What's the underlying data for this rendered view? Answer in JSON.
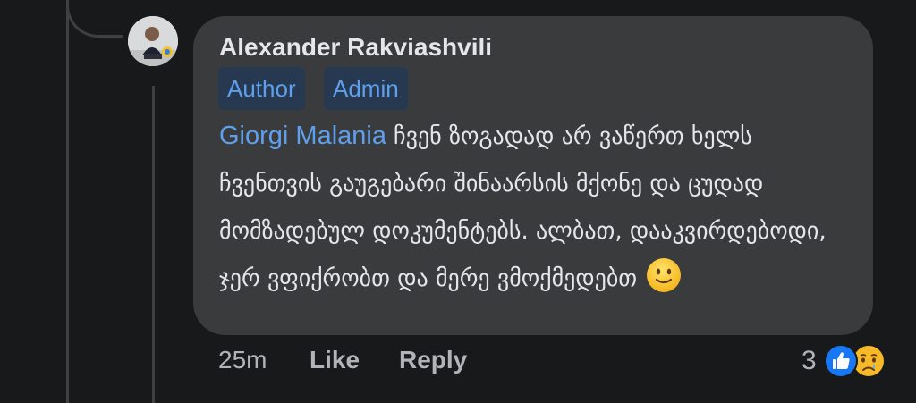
{
  "comment": {
    "author": "Alexander Rakviashvili",
    "badges": [
      "Author",
      "Admin"
    ],
    "mention": "Giorgi Malania",
    "text": "ჩვენ ზოგადად არ ვაწერთ ხელს ჩვენთვის გაუგებარი შინაარსის მქონე და ცუდად მომზადებულ დოკუმენტებს. ალბათ, დააკვირდებოდი, ჯერ ვფიქრობთ და მერე ვმოქმედებთ",
    "emoji": "slightly-smiling-face-icon",
    "timestamp": "25m",
    "like_label": "Like",
    "reply_label": "Reply",
    "reactions": {
      "count": "3",
      "types": [
        "like-icon",
        "sad-icon"
      ]
    }
  },
  "colors": {
    "background": "#18191a",
    "bubble": "#3a3b3c",
    "text": "#e4e6eb",
    "secondary_text": "#b0b3b8",
    "link": "#5fa0ee",
    "badge_bg": "#263951",
    "like_blue": "#1877f2",
    "sad_yellow": "#f7b928"
  }
}
